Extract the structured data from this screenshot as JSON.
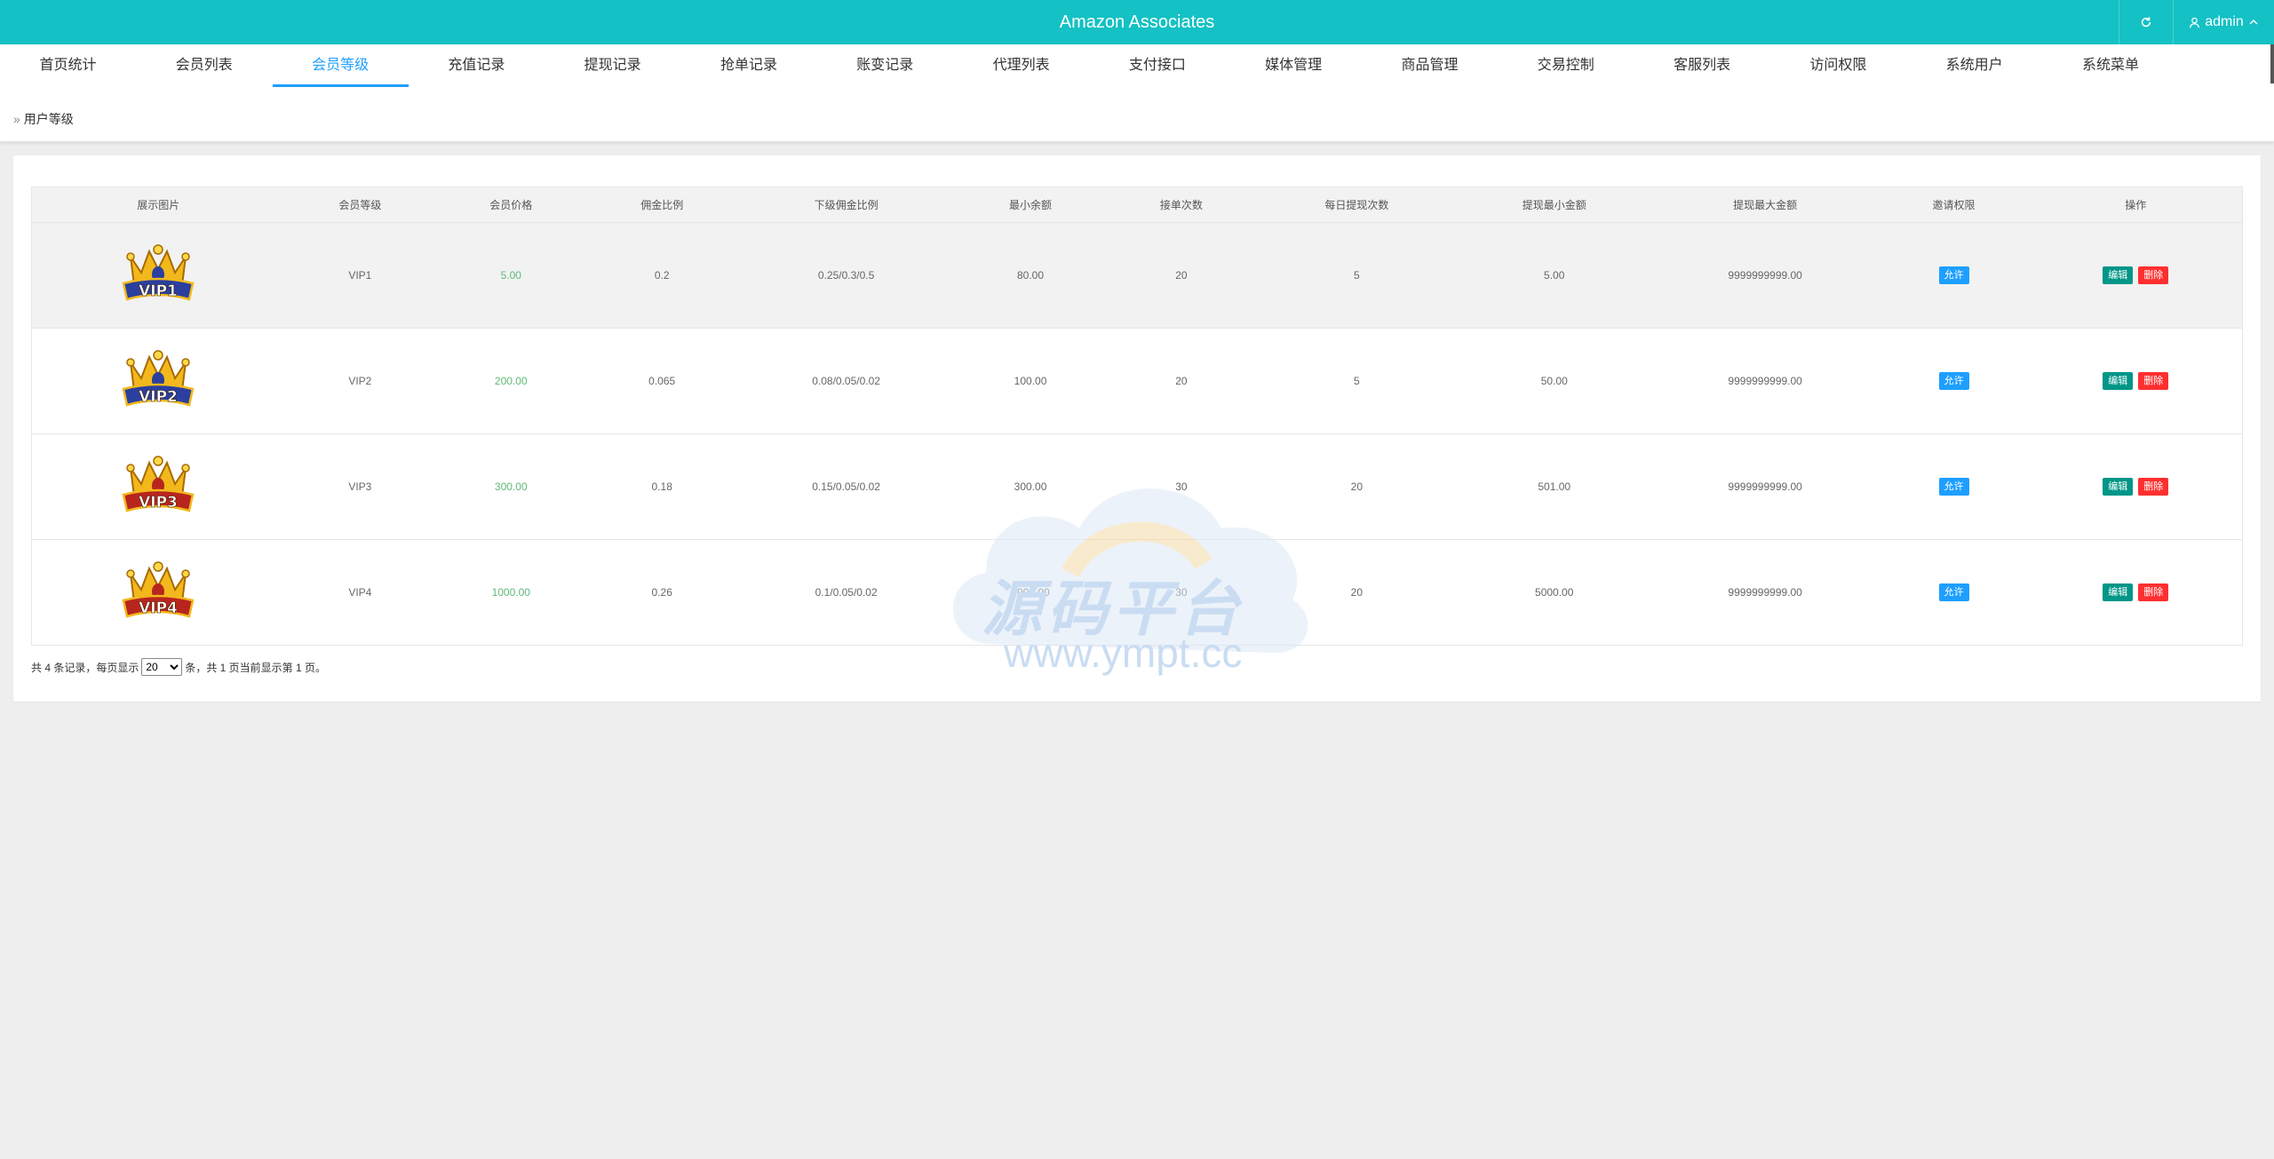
{
  "header": {
    "title": "Amazon Associates",
    "user": "admin",
    "refresh_icon": "refresh-icon",
    "user_icon": "user-icon"
  },
  "nav": {
    "active_index": 2,
    "items": [
      {
        "label": "首页统计"
      },
      {
        "label": "会员列表"
      },
      {
        "label": "会员等级"
      },
      {
        "label": "充值记录"
      },
      {
        "label": "提现记录"
      },
      {
        "label": "抢单记录"
      },
      {
        "label": "账变记录"
      },
      {
        "label": "代理列表"
      },
      {
        "label": "支付接口"
      },
      {
        "label": "媒体管理"
      },
      {
        "label": "商品管理"
      },
      {
        "label": "交易控制"
      },
      {
        "label": "客服列表"
      },
      {
        "label": "访问权限"
      },
      {
        "label": "系统用户"
      },
      {
        "label": "系统菜单"
      }
    ]
  },
  "breadcrumb": {
    "arrow": "»",
    "label": "用户等级"
  },
  "table": {
    "columns": [
      "展示图片",
      "会员等级",
      "会员价格",
      "佣金比例",
      "下级佣金比例",
      "最小余额",
      "接单次数",
      "每日提现次数",
      "提现最小金额",
      "提现最大金额",
      "邀请权限",
      "操作"
    ],
    "rows": [
      {
        "badge": "VIP1",
        "badge_color": "#2a3f9e",
        "level": "VIP1",
        "price": "5.00",
        "commission": "0.2",
        "sub_commission": "0.25/0.3/0.5",
        "min_balance": "80.00",
        "orders": "20",
        "daily_withdraw": "5",
        "withdraw_min": "5.00",
        "withdraw_max": "9999999999.00",
        "invite": "允许",
        "edit": "编辑",
        "delete": "删除"
      },
      {
        "badge": "VIP2",
        "badge_color": "#2a3f9e",
        "level": "VIP2",
        "price": "200.00",
        "commission": "0.065",
        "sub_commission": "0.08/0.05/0.02",
        "min_balance": "100.00",
        "orders": "20",
        "daily_withdraw": "5",
        "withdraw_min": "50.00",
        "withdraw_max": "9999999999.00",
        "invite": "允许",
        "edit": "编辑",
        "delete": "删除"
      },
      {
        "badge": "VIP3",
        "badge_color": "#b8251e",
        "level": "VIP3",
        "price": "300.00",
        "commission": "0.18",
        "sub_commission": "0.15/0.05/0.02",
        "min_balance": "300.00",
        "orders": "30",
        "daily_withdraw": "20",
        "withdraw_min": "501.00",
        "withdraw_max": "9999999999.00",
        "invite": "允许",
        "edit": "编辑",
        "delete": "删除"
      },
      {
        "badge": "VIP4",
        "badge_color": "#b8251e",
        "level": "VIP4",
        "price": "1000.00",
        "commission": "0.26",
        "sub_commission": "0.1/0.05/0.02",
        "min_balance": "1000.00",
        "orders": "30",
        "daily_withdraw": "20",
        "withdraw_min": "5000.00",
        "withdraw_max": "9999999999.00",
        "invite": "允许",
        "edit": "编辑",
        "delete": "删除"
      }
    ]
  },
  "pager": {
    "prefix": "共 4 条记录，每页显示",
    "page_size": "20",
    "suffix": "条，共 1 页当前显示第 1 页。"
  },
  "watermark": {
    "text": "源码平台",
    "url": "www.ympt.cc"
  }
}
